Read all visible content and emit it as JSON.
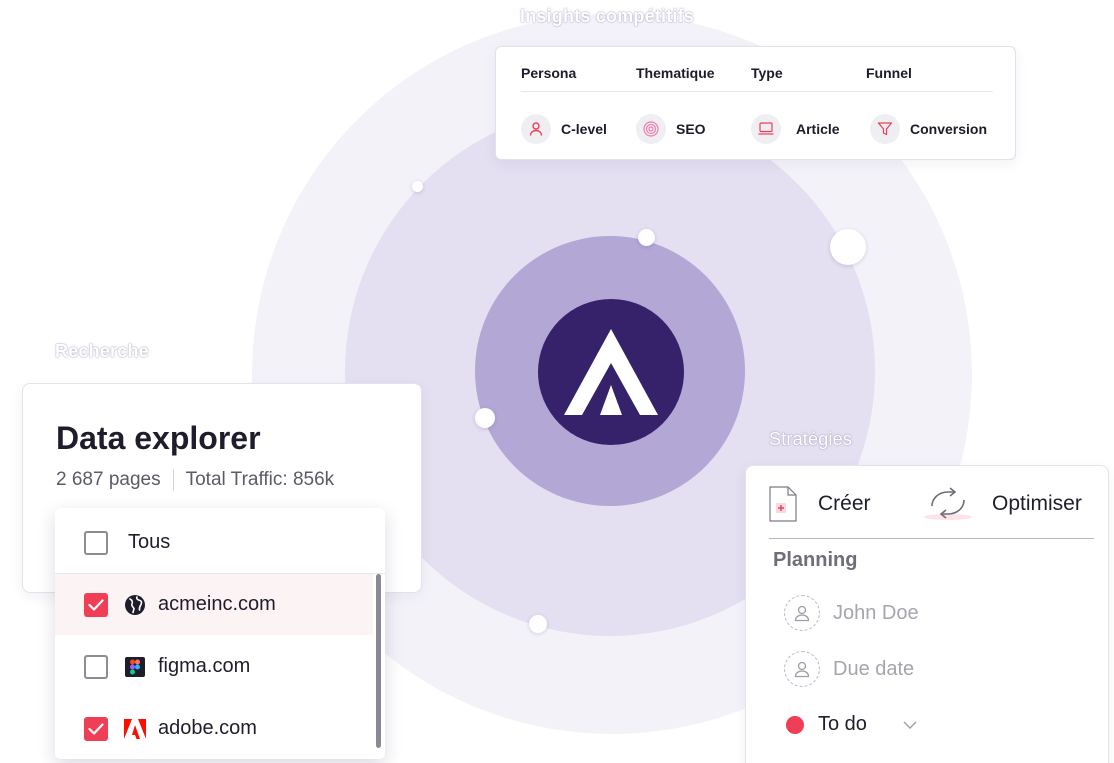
{
  "titles": {
    "insights": "Insights compétitifs",
    "recherche": "Recherche",
    "strategies": "Stratégies"
  },
  "insights": {
    "headers": [
      "Persona",
      "Thematique",
      "Type",
      "Funnel"
    ],
    "values": [
      {
        "label": "C-level",
        "icon": "user-icon"
      },
      {
        "label": "SEO",
        "icon": "target-icon"
      },
      {
        "label": "Article",
        "icon": "laptop-icon"
      },
      {
        "label": "Conversion",
        "icon": "funnel-icon"
      }
    ]
  },
  "explorer": {
    "title": "Data explorer",
    "pages": "2 687 pages",
    "traffic": "Total Traffic: 856k",
    "all_label": "Tous",
    "domains": [
      {
        "label": "acmeinc.com",
        "checked": true,
        "icon": "globe-icon"
      },
      {
        "label": "figma.com",
        "checked": false,
        "icon": "figma-logo-icon"
      },
      {
        "label": "adobe.com",
        "checked": true,
        "icon": "adobe-logo-icon"
      }
    ]
  },
  "strategy": {
    "create_label": "Créer",
    "optimize_label": "Optimiser",
    "planning_label": "Planning",
    "assignee": "John Doe",
    "due_date": "Due date",
    "status": "To do",
    "status_color": "#ef3e56"
  },
  "colors": {
    "accent": "#ef3e56",
    "brand_core": "#35226b",
    "ring_inner": "#b3a7d6",
    "ring_mid": "#e4dff1",
    "ring_outer": "#f4f2f9"
  }
}
